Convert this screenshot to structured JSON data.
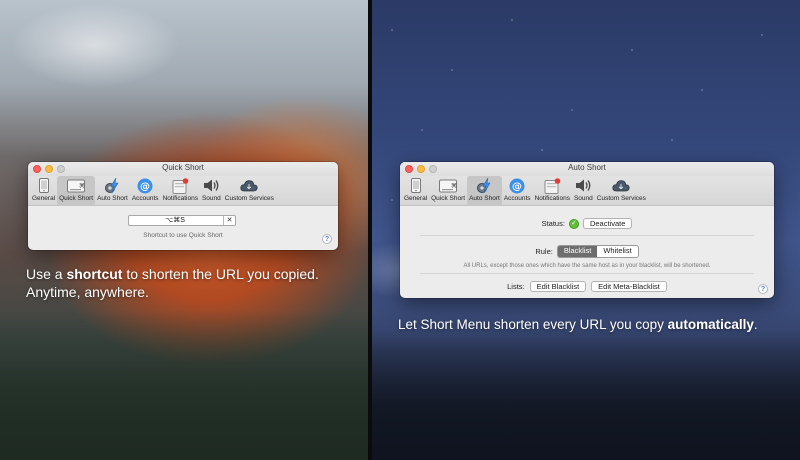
{
  "colors": {
    "accent_blue": "#3d8fe8",
    "status_green": "#5fbf3a",
    "notification_badge": "#e23b35"
  },
  "left_window": {
    "title": "Quick Short",
    "toolbar": [
      {
        "label": "General",
        "icon": "phone-icon"
      },
      {
        "label": "Quick Short",
        "icon": "keyboard-icon"
      },
      {
        "label": "Auto Short",
        "icon": "lightning-gear-icon"
      },
      {
        "label": "Accounts",
        "icon": "at-sign-icon"
      },
      {
        "label": "Notifications",
        "icon": "notification-badge-icon"
      },
      {
        "label": "Sound",
        "icon": "speaker-icon"
      },
      {
        "label": "Custom Services",
        "icon": "cloud-icon"
      }
    ],
    "selected_tab": "Quick Short",
    "shortcut_value": "⌥⌘S",
    "shortcut_clear": "✕",
    "shortcut_caption": "Shortcut to use Quick Short",
    "help": "?"
  },
  "right_window": {
    "title": "Auto Short",
    "toolbar": [
      {
        "label": "General",
        "icon": "phone-icon"
      },
      {
        "label": "Quick Short",
        "icon": "keyboard-icon"
      },
      {
        "label": "Auto Short",
        "icon": "lightning-gear-icon"
      },
      {
        "label": "Accounts",
        "icon": "at-sign-icon"
      },
      {
        "label": "Notifications",
        "icon": "notification-badge-icon"
      },
      {
        "label": "Sound",
        "icon": "speaker-icon"
      },
      {
        "label": "Custom Services",
        "icon": "cloud-icon"
      }
    ],
    "selected_tab": "Auto Short",
    "status_label": "Status:",
    "status_button": "Deactivate",
    "rule_label": "Rule:",
    "rule_options": [
      "Blacklist",
      "Whitelist"
    ],
    "rule_selected": "Blacklist",
    "rule_description": "All URLs, except those ones which have the same host as in your blacklist, will be shortened.",
    "lists_label": "Lists:",
    "edit_blacklist": "Edit Blacklist",
    "edit_meta_blacklist": "Edit Meta-Blacklist",
    "help": "?"
  },
  "left_tagline": {
    "pre": "Use a ",
    "bold": "shortcut",
    "post": " to shorten the URL you copied.",
    "line2": "Anytime, anywhere."
  },
  "right_tagline": {
    "pre": "Let Short Menu shorten every URL you copy ",
    "bold": "automatically",
    "post": "."
  }
}
